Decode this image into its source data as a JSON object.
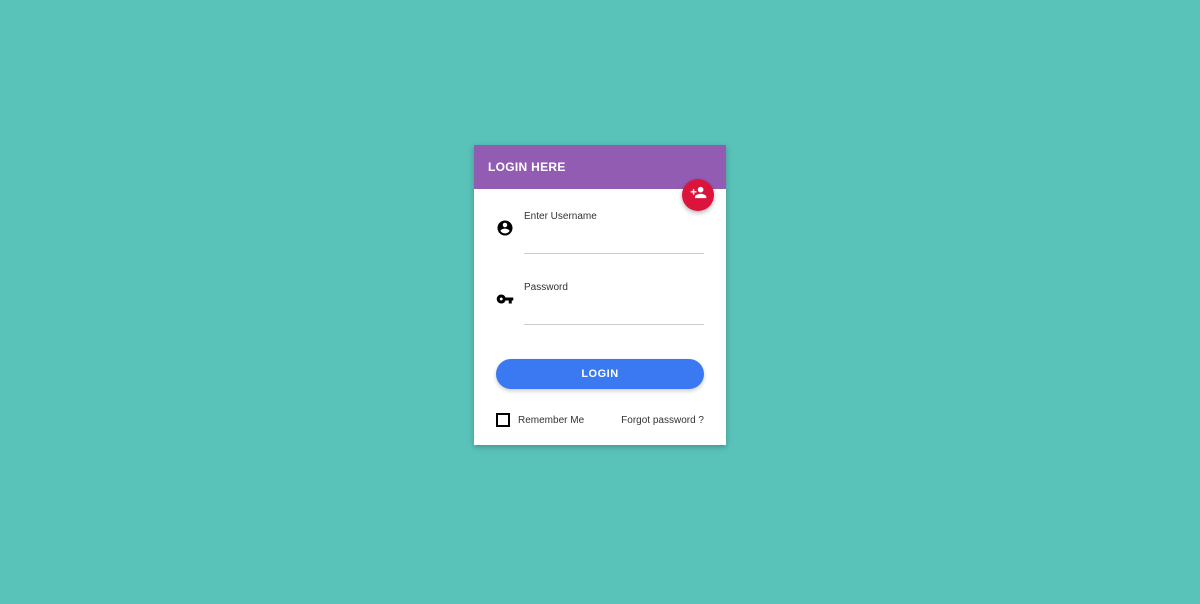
{
  "header": {
    "title": "LOGIN HERE"
  },
  "form": {
    "username_label": "Enter Username",
    "username_value": "",
    "password_label": "Password",
    "password_value": "",
    "login_button": "LOGIN"
  },
  "footer": {
    "remember_label": "Remember Me",
    "forgot_label": "Forgot password ?"
  },
  "colors": {
    "bg": "#59c3ba",
    "header": "#925cb3",
    "fab": "#dc143c",
    "button": "#3a79f1"
  }
}
